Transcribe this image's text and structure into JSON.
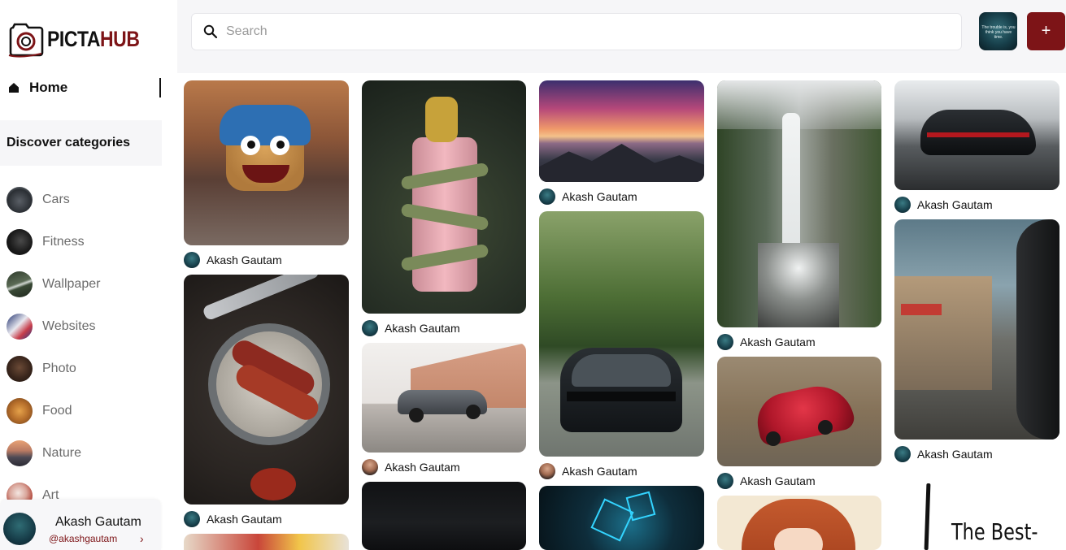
{
  "brand": {
    "part1": "PICTA",
    "part2": "HUB",
    "accent": "#7d1417"
  },
  "sidebar": {
    "home_label": "Home",
    "discover_label": "Discover categories",
    "categories": [
      {
        "label": "Cars"
      },
      {
        "label": "Fitness"
      },
      {
        "label": "Wallpaper"
      },
      {
        "label": "Websites"
      },
      {
        "label": "Photo"
      },
      {
        "label": "Food"
      },
      {
        "label": "Nature"
      },
      {
        "label": "Art"
      }
    ],
    "user": {
      "name": "Akash Gautam",
      "handle": "@akashgautam",
      "chevron": "›"
    }
  },
  "header": {
    "search_placeholder": "Search",
    "avatar_text": "The trouble is, you think you have time.",
    "add_label": "+"
  },
  "pins": [
    {
      "author": "Akash Gautam",
      "subject": "cartoon-monster"
    },
    {
      "author": "Akash Gautam",
      "subject": "food-skewers"
    },
    {
      "author": "Akash Gautam",
      "subject": "dragon-tower"
    },
    {
      "author": "Akash Gautam",
      "subject": "sports-car"
    },
    {
      "author": "Akash Gautam",
      "subject": "sunset-mountains"
    },
    {
      "author": "Akash Gautam",
      "subject": "audi-forest"
    },
    {
      "author": "Akash Gautam",
      "subject": "waterfall"
    },
    {
      "author": "Akash Gautam",
      "subject": "red-sportscar"
    },
    {
      "author": "Akash Gautam",
      "subject": "porsche-road"
    },
    {
      "author": "Akash Gautam",
      "subject": "rainy-window"
    }
  ],
  "quote_card": {
    "text": "The Best-"
  }
}
